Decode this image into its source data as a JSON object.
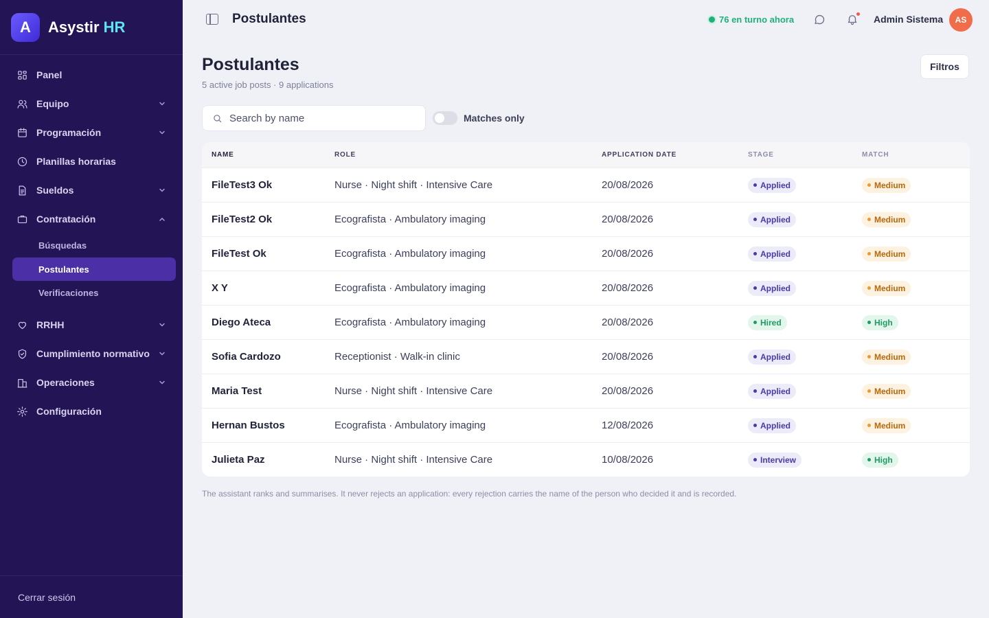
{
  "brand": {
    "letter": "A",
    "name": "Asystir",
    "accent": "HR"
  },
  "nav": [
    {
      "label": "Panel",
      "icon": "grid-icon",
      "expandable": false
    },
    {
      "label": "Equipo",
      "icon": "users-icon",
      "expandable": true
    },
    {
      "label": "Programación",
      "icon": "calendar-icon",
      "expandable": true
    },
    {
      "label": "Planillas horarias",
      "icon": "clock-icon",
      "expandable": false
    },
    {
      "label": "Sueldos",
      "icon": "document-icon",
      "expandable": true
    },
    {
      "label": "Contratación",
      "icon": "briefcase-icon",
      "expandable": true,
      "expanded": true
    }
  ],
  "subnav": [
    {
      "label": "Búsquedas"
    },
    {
      "label": "Postulantes",
      "active": true
    },
    {
      "label": "Verificaciones"
    }
  ],
  "nav2": [
    {
      "label": "RRHH",
      "icon": "heart-icon",
      "expandable": true
    },
    {
      "label": "Cumplimiento normativo",
      "icon": "shield-icon",
      "expandable": true
    },
    {
      "label": "Operaciones",
      "icon": "building-icon",
      "expandable": true
    },
    {
      "label": "Configuración",
      "icon": "gear-icon",
      "expandable": false
    }
  ],
  "logout_label": "Cerrar sesión",
  "topbar": {
    "title": "Postulantes",
    "shift_status": "76 en turno ahora",
    "user_name": "Admin Sistema",
    "avatar_initials": "AS"
  },
  "main": {
    "title": "Postulantes",
    "subtitle": "5 active job posts · 9 applications",
    "filter_label": "Filtros",
    "search_placeholder": "Search by name",
    "toggle_label": "Matches only",
    "toggle_on": false,
    "footnote": "The assistant ranks and summarises. It never rejects an application: every rejection carries the name of the person who decided it and is recorded."
  },
  "table": {
    "headers": [
      "NAME",
      "ROLE",
      "APPLICATION DATE",
      "STAGE",
      "MATCH"
    ],
    "rows": [
      {
        "name": "FileTest3 Ok",
        "role": "Nurse · Night shift · Intensive Care",
        "date": "20/08/2026",
        "stage": "Applied",
        "match": "Medium"
      },
      {
        "name": "FileTest2 Ok",
        "role": "Ecografista · Ambulatory imaging",
        "date": "20/08/2026",
        "stage": "Applied",
        "match": "Medium"
      },
      {
        "name": "FileTest Ok",
        "role": "Ecografista · Ambulatory imaging",
        "date": "20/08/2026",
        "stage": "Applied",
        "match": "Medium"
      },
      {
        "name": "X Y",
        "role": "Ecografista · Ambulatory imaging",
        "date": "20/08/2026",
        "stage": "Applied",
        "match": "Medium"
      },
      {
        "name": "Diego Ateca",
        "role": "Ecografista · Ambulatory imaging",
        "date": "20/08/2026",
        "stage": "Hired",
        "match": "High"
      },
      {
        "name": "Sofia Cardozo",
        "role": "Receptionist · Walk-in clinic",
        "date": "20/08/2026",
        "stage": "Applied",
        "match": "Medium"
      },
      {
        "name": "Maria Test",
        "role": "Nurse · Night shift · Intensive Care",
        "date": "20/08/2026",
        "stage": "Applied",
        "match": "Medium"
      },
      {
        "name": "Hernan Bustos",
        "role": "Ecografista · Ambulatory imaging",
        "date": "12/08/2026",
        "stage": "Applied",
        "match": "Medium"
      },
      {
        "name": "Julieta Paz",
        "role": "Nurse · Night shift · Intensive Care",
        "date": "10/08/2026",
        "stage": "Interview",
        "match": "High"
      }
    ]
  },
  "colors": {
    "sidebar_bg": "#231455",
    "active_item": "#4a2fa6",
    "online_green": "#20b07a",
    "avatar": "#f06c4a"
  }
}
